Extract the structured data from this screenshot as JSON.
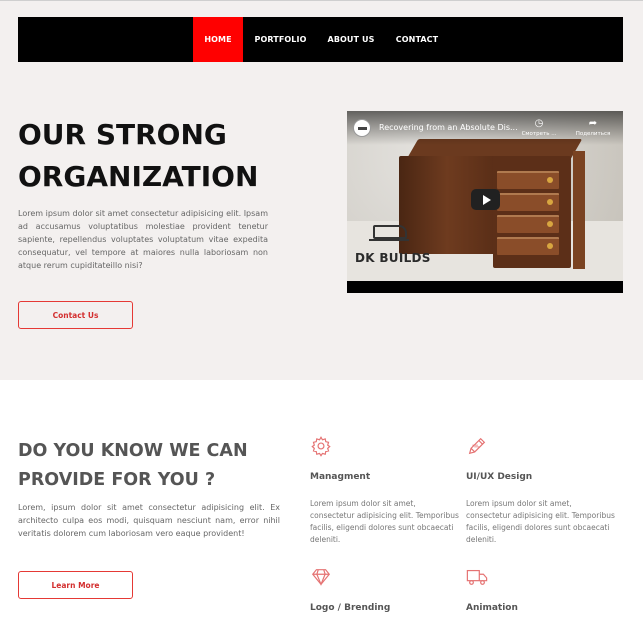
{
  "nav": {
    "items": [
      {
        "label": "HOME",
        "active": true
      },
      {
        "label": "PORTFOLIO",
        "active": false
      },
      {
        "label": "ABOUT US",
        "active": false
      },
      {
        "label": "CONTACT",
        "active": false
      }
    ]
  },
  "hero": {
    "title_line1": "OUR STRONG",
    "title_line2": "ORGANIZATION",
    "body": "Lorem ipsum dolor sit amet consectetur adipisicing elit. Ipsam ad accusamus voluptatibus molestiae provident tenetur sapiente, repellendus voluptates voluptatum vitae expedita consequatur, vel tempore at maiores nulla laboriosam non atque rerum cupiditateillo nisi?",
    "contact_button": "Contact Us"
  },
  "video": {
    "title": "Recovering from an Absolute Dis...",
    "watch_label": "Смотреть ...",
    "share_label": "Поделиться",
    "watermark": "DK BUILDS",
    "channel_icon": "channel-avatar",
    "play_icon": "play-icon"
  },
  "section2": {
    "title_line1": "DO YOU KNOW WE CAN",
    "title_line2": "PROVIDE FOR YOU ?",
    "body": "Lorem, ipsum dolor sit amet consectetur adipisicing elit. Ex architecto culpa eos modi, quisquam nesciunt nam, error nihil veritatis dolorem cum laboriosam vero eaque provident!",
    "learn_button": "Learn More",
    "features": [
      {
        "icon": "gear-icon",
        "title": "Managment",
        "text": "Lorem ipsum dolor sit amet, consectetur adipisicing elit. Temporibus facilis, eligendi dolores sunt obcaecati deleniti."
      },
      {
        "icon": "pencil-icon",
        "title": "UI/UX Design",
        "text": "Lorem ipsum dolor sit amet, consectetur adipisicing elit. Temporibus facilis, eligendi dolores sunt obcaecati deleniti."
      },
      {
        "icon": "diamond-icon",
        "title": "Logo / Brending",
        "text": ""
      },
      {
        "icon": "truck-icon",
        "title": "Animation",
        "text": ""
      }
    ]
  },
  "colors": {
    "accent": "#ff0000",
    "navbar": "#000000",
    "hero_bg": "#f3f0ef",
    "icon": "#e57373"
  }
}
